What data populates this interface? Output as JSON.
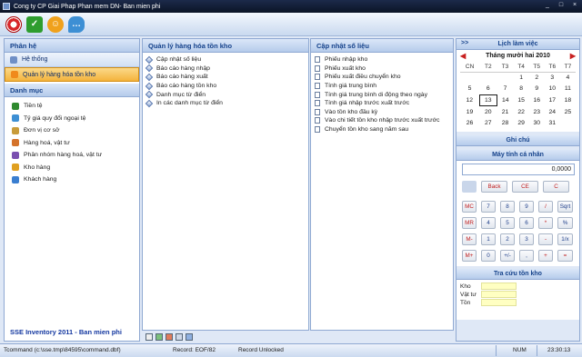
{
  "window": {
    "title": "Cong ty CP Giai Phap Phan mem DN- Ban mien phi",
    "controls": [
      "_",
      "□",
      "×"
    ]
  },
  "toolbar": {
    "icons": [
      "lifebuoy-icon",
      "checkmark-icon",
      "smiley-icon",
      "chat-bubble-icon"
    ]
  },
  "left": {
    "header": "Phân hệ",
    "modules": [
      {
        "label": "Hệ thống",
        "selected": false
      },
      {
        "label": "Quản lý hàng hóa tồn kho",
        "selected": true
      }
    ],
    "danhmuc_header": "Danh mục",
    "danhmuc": [
      {
        "label": "Tiền tệ",
        "icon": "coins-icon",
        "color": "#2f8a2f"
      },
      {
        "label": "Tỷ giá quy đổi ngoại tệ",
        "icon": "exchange-rate-icon",
        "color": "#3d8fd4"
      },
      {
        "label": "Đơn vị cơ sở",
        "icon": "unit-icon",
        "color": "#c89b3a"
      },
      {
        "label": "Hàng hoá, vật tư",
        "icon": "goods-icon",
        "color": "#d4722a"
      },
      {
        "label": "Phân nhóm hàng hoá, vật tư",
        "icon": "group-icon",
        "color": "#7a4fb0"
      },
      {
        "label": "Kho hàng",
        "icon": "warehouse-icon",
        "color": "#e0a020"
      },
      {
        "label": "Khách hàng",
        "icon": "customer-icon",
        "color": "#3a7ed0"
      }
    ],
    "footer": "SSE Inventory 2011 - Ban mien phi"
  },
  "inventory": {
    "header": "Quản lý hàng hóa tồn kho",
    "items": [
      "Cập nhật số liệu",
      "Báo cáo hàng nhập",
      "Báo cáo hàng xuất",
      "Báo cáo hàng tồn kho",
      "Danh mục từ điển",
      "In các danh mục từ điển"
    ]
  },
  "update": {
    "header": "Cập nhật số liệu",
    "items": [
      "Phiếu nhập kho",
      "Phiếu xuất kho",
      "Phiếu xuất điều chuyển kho",
      "Tính giá trung bình",
      "Tính giá trung bình di động theo ngày",
      "Tính giá nhập trước xuất trước",
      "Vào tồn kho đầu kỳ",
      "Vào chi tiết tồn kho nhập trước xuất trước",
      "Chuyển tồn kho sang năm sau"
    ]
  },
  "calendar": {
    "header": "Lịch làm việc",
    "arrows": ">>",
    "month": "Tháng mười hai 2010",
    "prev": "◀",
    "next": "▶",
    "weekdays": [
      "CN",
      "T2",
      "T3",
      "T4",
      "T5",
      "T6",
      "T7"
    ],
    "weeks": [
      [
        "",
        "",
        "",
        "1",
        "2",
        "3",
        "4"
      ],
      [
        "5",
        "6",
        "7",
        "8",
        "9",
        "10",
        "11"
      ],
      [
        "12",
        "13",
        "14",
        "15",
        "16",
        "17",
        "18"
      ],
      [
        "19",
        "20",
        "21",
        "22",
        "23",
        "24",
        "25"
      ],
      [
        "26",
        "27",
        "28",
        "29",
        "30",
        "31",
        ""
      ]
    ],
    "today": "13"
  },
  "notes": {
    "header": "Ghi chú"
  },
  "calculator": {
    "header": "Máy tính cá nhân",
    "display": "0,0000",
    "keys": {
      "back": "Back",
      "ce": "CE",
      "c": "C",
      "mc": "MC",
      "mr": "MR",
      "ms": "M-",
      "mplus": "M+",
      "k7": "7",
      "k8": "8",
      "k9": "9",
      "div": "/",
      "sqrt": "Sqrt",
      "k4": "4",
      "k5": "5",
      "k6": "6",
      "mul": "*",
      "pct": "%",
      "k1": "1",
      "k2": "2",
      "k3": "3",
      "sub": "-",
      "inv": "1/x",
      "k0": "0",
      "sign": "+/-",
      "dot": ",",
      "add": "+",
      "eq": "="
    }
  },
  "lookup": {
    "header": "Tra cứu tồn kho",
    "fields": [
      "Kho",
      "Vật tư",
      "Tồn"
    ]
  },
  "statusbar": {
    "command": "Tcommand (c:\\sse.tmp\\84595\\command.dbf)",
    "record": "Record: EOF/82",
    "lock": "Record Unlocked",
    "num": "NUM",
    "time": "23:30:13"
  }
}
